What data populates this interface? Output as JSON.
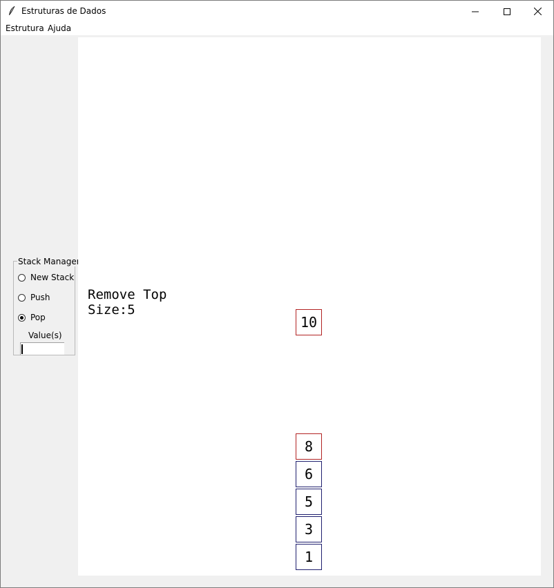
{
  "window": {
    "title": "Estruturas de Dados",
    "icons": {
      "app": "feather-icon",
      "minimize": "minimize-icon",
      "maximize": "maximize-icon",
      "close": "close-icon"
    }
  },
  "menu": {
    "items": [
      "Estrutura",
      "Ajuda"
    ]
  },
  "stack_manager": {
    "title": "Stack Manager",
    "options": [
      {
        "label": "New Stack",
        "checked": false
      },
      {
        "label": "Push",
        "checked": false
      },
      {
        "label": "Pop",
        "checked": true
      }
    ],
    "values_label": "Value(s)",
    "values_input": ""
  },
  "canvas": {
    "operation": "Remove Top",
    "size_text": "Size:5",
    "popped": {
      "value": "10",
      "color": "#b22222"
    },
    "stack": [
      {
        "value": "8",
        "color": "#b22222"
      },
      {
        "value": "6",
        "color": "#1f1f6e"
      },
      {
        "value": "5",
        "color": "#1f1f6e"
      },
      {
        "value": "3",
        "color": "#1f1f6e"
      },
      {
        "value": "1",
        "color": "#1f1f6e"
      }
    ]
  }
}
